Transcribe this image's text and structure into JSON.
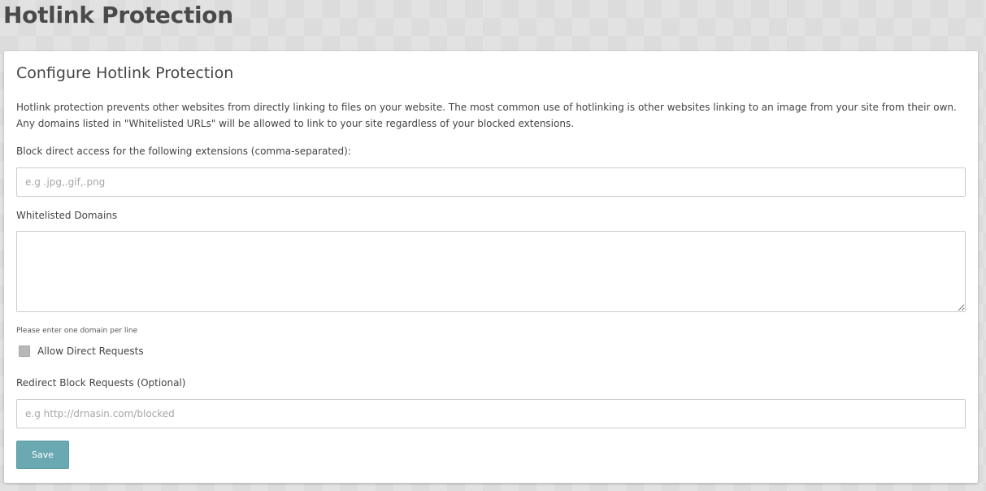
{
  "page": {
    "title": "Hotlink Protection"
  },
  "card": {
    "title": "Configure Hotlink Protection",
    "intro": "Hotlink protection prevents other websites from directly linking to files on your website. The most common use of hotlinking is other websites linking to an image from your site from their own. Any domains listed in \"Whitelisted URLs\" will be allowed to link to your site regardless of your blocked extensions."
  },
  "form": {
    "extensions_label": "Block direct access for the following extensions (comma-separated):",
    "extensions_value": "",
    "extensions_placeholder": "e.g .jpg,.gif,.png",
    "domains_label": "Whitelisted Domains",
    "domains_value": "",
    "domains_help": "Please enter one domain per line",
    "allow_direct_label": "Allow Direct Requests",
    "allow_direct_checked": false,
    "redirect_label": "Redirect Block Requests (Optional)",
    "redirect_value": "",
    "redirect_placeholder": "e.g http://drnasin.com/blocked",
    "save_label": "Save"
  },
  "colors": {
    "accent": "#6aa9b2",
    "background": "#dcdcdc",
    "card": "#ffffff"
  }
}
